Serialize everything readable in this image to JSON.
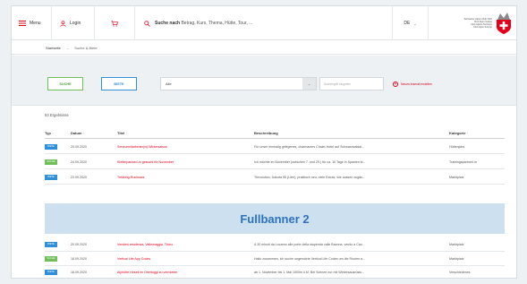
{
  "header": {
    "menu_label": "Menu",
    "login_label": "Login",
    "search_bold": "Suche nach",
    "search_rest": "Betrag, Kurs, Thema, Hütte, Tour, ...",
    "lang": "DE",
    "logo_text": "Schweizer Alpen-Club SAC\nClub Alpin Suisse\nClub Alpino Svizzero\nClub Alpin Svizzer",
    "accent": "#e2001a"
  },
  "breadcrumb": {
    "first": "Startseite",
    "second": "Suche & Biete"
  },
  "filters": {
    "suche_label": "SUCHE",
    "biete_label": "BIETE",
    "select_value": "Alle",
    "search_placeholder": "Suchbegriff eingeben",
    "new_label": "Neues Inserat erstellen"
  },
  "results": {
    "count": "53 Ergebnisse",
    "columns": {
      "typ": "Typ",
      "datum": "Datum",
      "titel": "Titel",
      "beschreibung": "Beschreibung",
      "kategorie": "Kategorie"
    },
    "rows": [
      {
        "type": "BIETE",
        "date": "25.09.2020",
        "title": "Servicemitarbeiter(in) Wintersaison",
        "desc": "Für unser einmalig gelegenes, charmantes Chalet-Hotel auf Schwarzwaldal...",
        "cat": "Hüttenjobs"
      },
      {
        "type": "SUCHE",
        "date": "24.09.2020",
        "title": "Kletterpartner/-in gesucht für November",
        "desc": "Ich möchte im November (zwischen 7. und 29.) für ca. 10 Tage in Spanien kl...",
        "cat": "Trainingspartner/-in"
      },
      {
        "type": "BIETE",
        "date": "23.09.2020",
        "title": "Trekking-Rucksack",
        "desc": "Trevolution, Dakota 55 (Liter), praktisch neu, viele Extras, wie aussen zugän...",
        "cat": "Marktplatz"
      },
      {
        "type": "BIETE",
        "date": "20.09.2020",
        "title": "Vendesi residenza, Vallemaggia, Ticino",
        "desc": "A 30 minuti da Locarno alle porte della stupenda valle Bavona, vendo a Cav...",
        "cat": "Marktplatz"
      },
      {
        "type": "SUCHE",
        "date": "18.09.2020",
        "title": "Vertical Life App Codes",
        "desc": "Hallo zusammen, ich suche ungenutzte Vertical Life Codes um die Routen a...",
        "cat": "Marktplatz"
      },
      {
        "type": "BIETE",
        "date": "18.09.2020",
        "title": "Alphütte Hirseli im Obertoggi zu vermieten",
        "desc": "ab 1. November bis 1. Mai 1500m ü.M. Bei Schnee nur mit Wintersausrüstu...",
        "cat": "Verschiedenes"
      }
    ]
  },
  "banner": {
    "label": "Fullbanner 2"
  }
}
